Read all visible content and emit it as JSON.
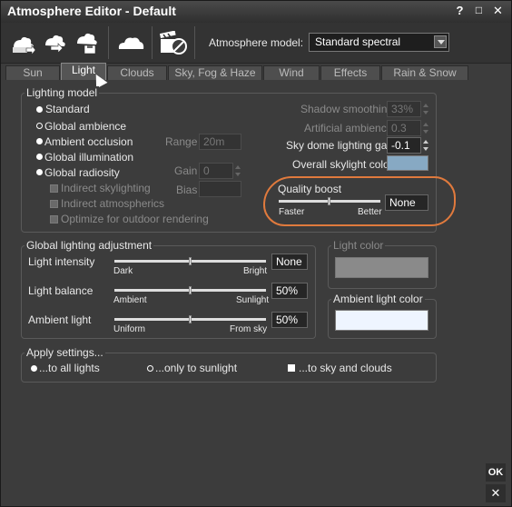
{
  "window": {
    "title": "Atmosphere Editor - Default"
  },
  "titlebar_buttons": [
    "?",
    "□",
    "✕"
  ],
  "toolbar": {
    "atmosphere_model_label": "Atmosphere model:",
    "atmosphere_model_value": "Standard spectral"
  },
  "tabs": [
    {
      "label": "Sun",
      "active": false
    },
    {
      "label": "Light",
      "active": true
    },
    {
      "label": "Clouds",
      "active": false
    },
    {
      "label": "Sky, Fog & Haze",
      "active": false
    },
    {
      "label": "Wind",
      "active": false
    },
    {
      "label": "Effects",
      "active": false
    },
    {
      "label": "Rain & Snow",
      "active": false
    }
  ],
  "lighting_model": {
    "title": "Lighting model",
    "options": [
      {
        "label": "Standard",
        "selected": true
      },
      {
        "label": "Global ambience",
        "selected": false
      },
      {
        "label": "Ambient occlusion",
        "selected": true
      },
      {
        "label": "Global illumination",
        "selected": true
      },
      {
        "label": "Global radiosity",
        "selected": true
      }
    ],
    "checkboxes": [
      "Indirect skylighting",
      "Indirect atmospherics",
      "Optimize for outdoor rendering"
    ],
    "range_label": "Range",
    "range_value": "20m",
    "gain_label": "Gain",
    "gain_value": "0",
    "bias_label": "Bias",
    "bias_value": "",
    "shadow_smoothing_label": "Shadow smoothing",
    "shadow_smoothing_value": "33%",
    "artificial_ambience_label": "Artificial ambience",
    "artificial_ambience_value": "0.3",
    "sky_dome_gain_label": "Sky dome lighting gain",
    "sky_dome_gain_value": "-0.1",
    "overall_skylight_label": "Overall skylight color",
    "overall_skylight_color": "#87a9c3",
    "quality_boost_label": "Quality boost",
    "quality_boost_low": "Faster",
    "quality_boost_high": "Better",
    "quality_boost_value": "None",
    "quality_boost_level": 0.5
  },
  "global_lighting": {
    "title": "Global lighting adjustment",
    "rows": [
      {
        "label": "Light intensity",
        "left": "Dark",
        "right": "Bright",
        "value": "None",
        "level": 0.5
      },
      {
        "label": "Light balance",
        "left": "Ambient",
        "right": "Sunlight",
        "value": "50%",
        "level": 0.5
      },
      {
        "label": "Ambient light",
        "left": "Uniform",
        "right": "From sky",
        "value": "50%",
        "level": 0.5
      }
    ]
  },
  "light_color": {
    "label": "Light color",
    "color": "#8a8a8a"
  },
  "ambient_light_color": {
    "label": "Ambient light color",
    "color": "#eef5ff"
  },
  "apply_settings": {
    "title": "Apply settings...",
    "options": [
      {
        "label": "...to all lights",
        "marker": "dot"
      },
      {
        "label": "...only to sunlight",
        "marker": "ring"
      },
      {
        "label": "...to sky and clouds",
        "marker": "box"
      }
    ]
  },
  "buttons": {
    "ok_label": "OK",
    "cancel_label": "✕"
  },
  "colors": {
    "annotation": "#e07a3d",
    "window_bg": "#3c3c3c"
  }
}
